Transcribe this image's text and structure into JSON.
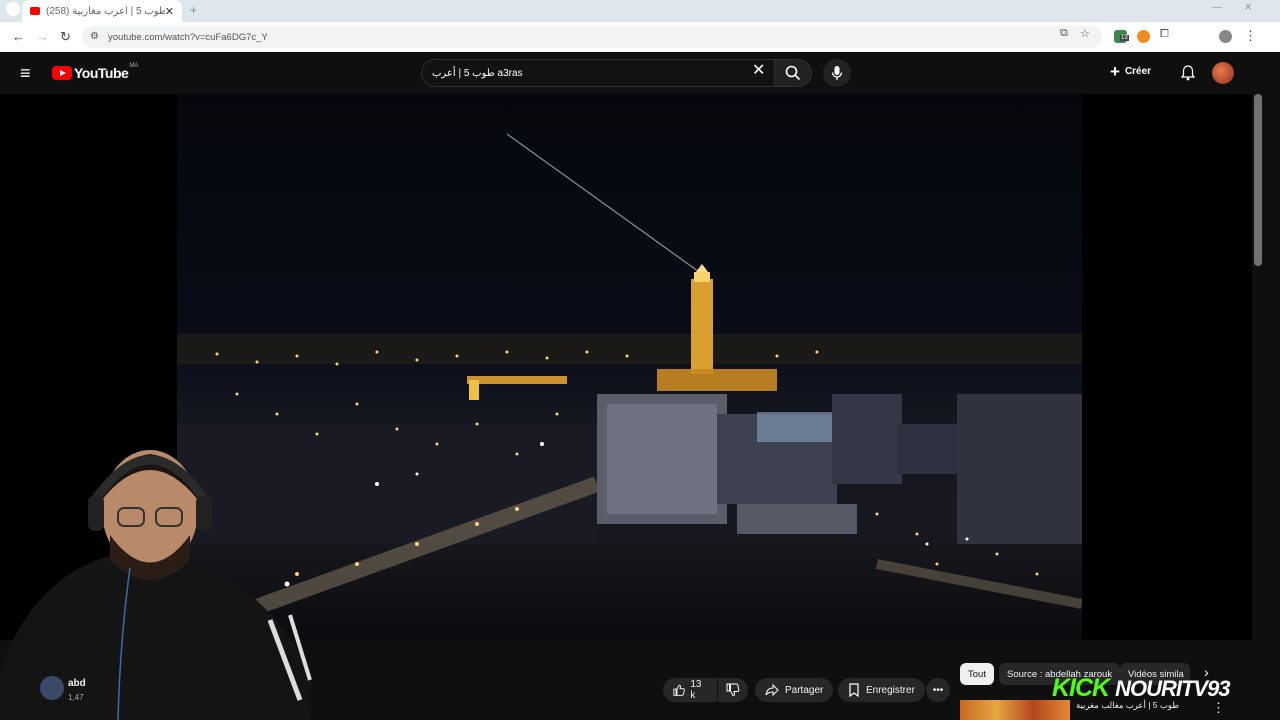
{
  "browser": {
    "tab_title": "طوب 5 | أعرب مغاربية",
    "tab_count": "(258)",
    "url": "youtube.com/watch?v=cuFa6DG7c_Y",
    "ext_badge": "13"
  },
  "youtube": {
    "logo_text": "YouTube",
    "country_code": "MA",
    "search_value": "طوب 5 | أعرب a3ras",
    "create_label": "Créer"
  },
  "video": {
    "colors": {
      "bg": "#000000",
      "accent": "#f0c040"
    }
  },
  "channel": {
    "name": "abd",
    "subs": "1,47"
  },
  "actions": {
    "like_count": "13 k",
    "share_label": "Partager",
    "save_label": "Enregistrer"
  },
  "chips": [
    {
      "label": "Tout"
    },
    {
      "label": "Source : abdellah zarouk"
    },
    {
      "label": "Vidéos simila"
    }
  ],
  "overlay": {
    "kick_word": "KICK",
    "kick_channel": "NOURITV93"
  },
  "related": {
    "title": "طوب 5 | أعرب مغالب مغربية"
  }
}
